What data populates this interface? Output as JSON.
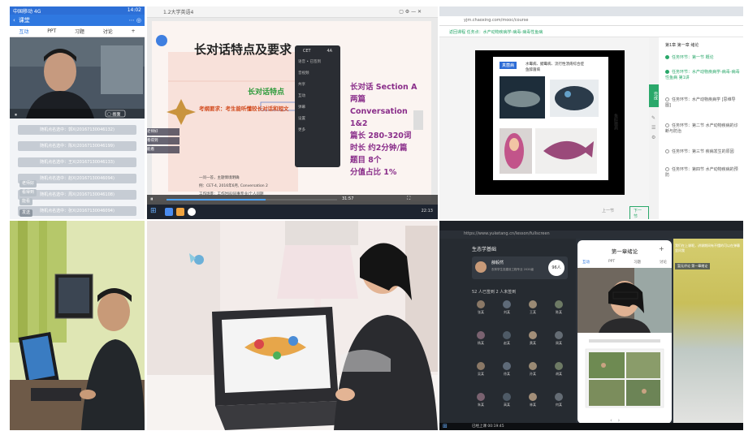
{
  "panel1": {
    "status_left": "中国移动 4G",
    "status_right": "14:02",
    "nav_title": "课堂",
    "tabs": [
      "互动",
      "PPT",
      "习题",
      "讨论"
    ],
    "plus": "+",
    "sign_rows": [
      "随机点名选中：郭X(20167130046132)",
      "随机点名选中：陈X(20167130046199)",
      "随机点名选中：王X(20167130046133)",
      "随机点名选中：赵X(20167130046094)",
      "随机点名选中：周X(20167130046108)",
      "随机点名选中：张X(20167130046094)"
    ],
    "chat_chips": [
      "老师好",
      "看得到",
      "能看"
    ],
    "bottom_chip": "发送"
  },
  "panel2": {
    "window_title": "1.2大学英语4",
    "slide_title": "长对话特点及要求",
    "tag_red": "长对话特点",
    "req_text": "考纲要求：考生能听懂较长对话和短文",
    "right_block": [
      "长对话 Section A",
      "两篇",
      "Conversation",
      "1&2",
      "篇长 280-320词",
      "时长 约2分钟/篇",
      "题目 8个",
      "分值占比 1%"
    ],
    "sub_bullets": [
      "一问一答，主题情境明确",
      "例：CET-4, 2016年6月, Conversation 2",
      "工作场景：工作时间/同事专业/个人问题"
    ],
    "time_left": "31:57",
    "time_right": "22:13",
    "popup_header_left": "CET",
    "popup_header_right": "4A",
    "popup_rows": [
      "语音 • 已签到",
      "音视频",
      "共享",
      "互动",
      "弹幕",
      "设置",
      "更多"
    ]
  },
  "panel3": {
    "url": "yjm.chaoxing.com/mooc/course",
    "breadcrumb": "返回课程  任务点：水产动物疾病学-病毒-病毒性鱼病",
    "slide_tag": "真菌病",
    "slide_lines": [
      "水霉病、鳃霉病、流行性溃疡综合症",
      "鱼醉菌病"
    ],
    "slide_vertical": "鱼醉菌病",
    "outline_header": "第1章 第一章 绪论",
    "outline": [
      {
        "label": "任务环节：第一节 概论",
        "active": true
      },
      {
        "label": "任务环节：水产动物疾病学-病毒-病毒性鱼病 第1讲",
        "active": true
      },
      {
        "label": "任务环节：水产动物疾病学 [思维导图]",
        "active": false
      },
      {
        "label": "任务环节：第二节 水产动物疾病的诊断与防治",
        "active": false
      },
      {
        "label": "任务环节：第三节 疾病发生的原因",
        "active": false
      },
      {
        "label": "任务环节：第四节 水产动物疾病的预防",
        "active": false
      }
    ],
    "green_btn": "完成",
    "footer_left": "上一节",
    "footer_right": "下一节"
  },
  "panel6": {
    "url": "https://www.yuketang.cn/lesson/fullscreen",
    "teacher_card": "生态学基础",
    "teacher_name": "薛毅然",
    "teacher_sub": "农林学生态建设工程专业 2020级",
    "count_badge": "96人",
    "section_label": "52 人已签到   2 人未签到",
    "students": [
      "张某",
      "刘某",
      "王某",
      "陈某",
      "杨某",
      "赵某",
      "黄某",
      "周某",
      "吴某",
      "徐某",
      "孙某",
      "胡某",
      "朱某",
      "高某",
      "林某",
      "何某"
    ],
    "phone_title": "第一章绪论",
    "phone_tabs": [
      "互动",
      "PPT",
      "习题",
      "讨论"
    ],
    "right_chip": "暂无评论 第一章绪论",
    "right_note": "我们在上课呢，讲课期间有不懂的可以在弹幕里问我",
    "bottom_bar": "已经上课 00:19:45"
  }
}
